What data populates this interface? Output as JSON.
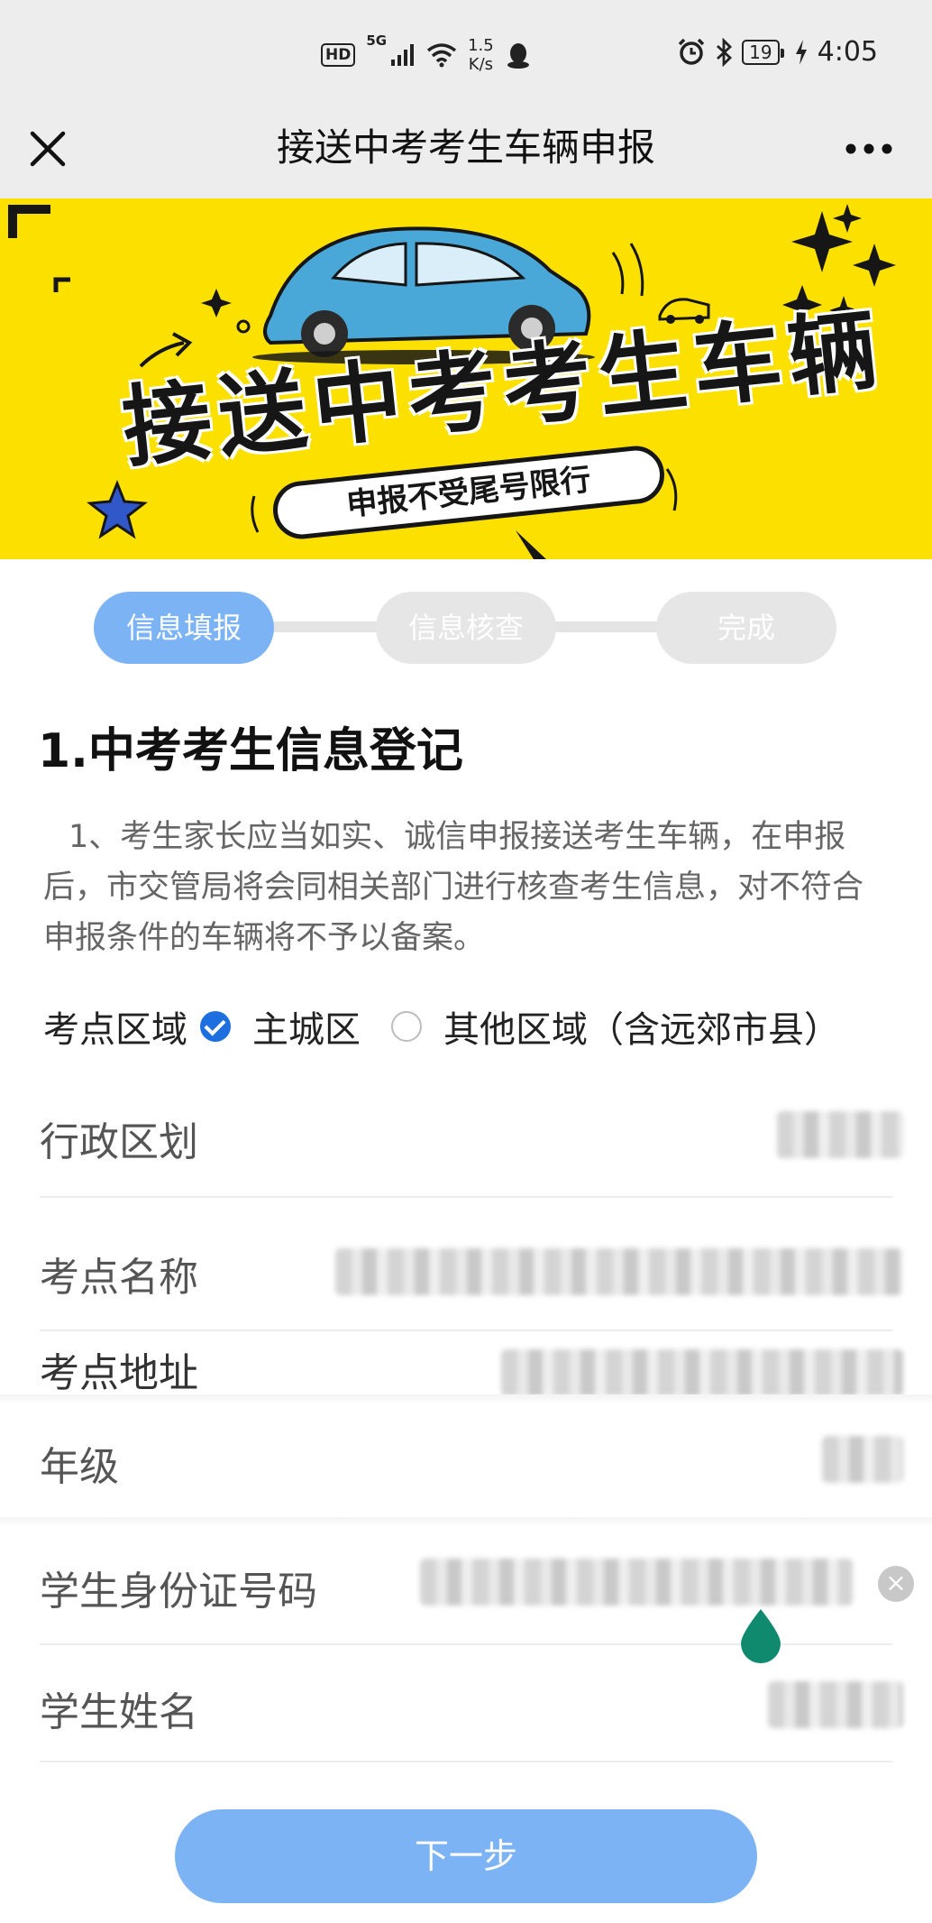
{
  "status_bar": {
    "hd": "HD",
    "network": "5G",
    "speed_value": "1.5",
    "speed_unit": "K/s",
    "battery": "19",
    "time": "4:05"
  },
  "nav": {
    "title": "接送中考考生车辆申报"
  },
  "banner": {
    "title": "接送中考考生车辆",
    "subtitle": "申报不受尾号限行"
  },
  "steps": [
    {
      "label": "信息填报",
      "active": true
    },
    {
      "label": "信息核查",
      "active": false
    },
    {
      "label": "完成",
      "active": false
    }
  ],
  "section": {
    "title": "1.中考考生信息登记",
    "notice": "1、考生家长应当如实、诚信申报接送考生车辆，在申报后，市交管局将会同相关部门进行核查考生信息，对不符合申报条件的车辆将不予以备案。"
  },
  "region": {
    "label": "考点区域",
    "options": [
      {
        "label": "主城区",
        "checked": true
      },
      {
        "label": "其他区域（含远郊市县）",
        "checked": false
      }
    ]
  },
  "fields": [
    {
      "label": "行政区划"
    },
    {
      "label": "考点名称"
    },
    {
      "label": "考点地址"
    },
    {
      "label": "年级"
    },
    {
      "label": "学生身份证号码"
    },
    {
      "label": "学生姓名"
    }
  ],
  "next_button": "下一步",
  "colors": {
    "accent": "#7cb3f5",
    "radio_checked": "#1d6fe0",
    "banner_bg": "#fce000",
    "cursor_handle": "#0f8a6e"
  }
}
